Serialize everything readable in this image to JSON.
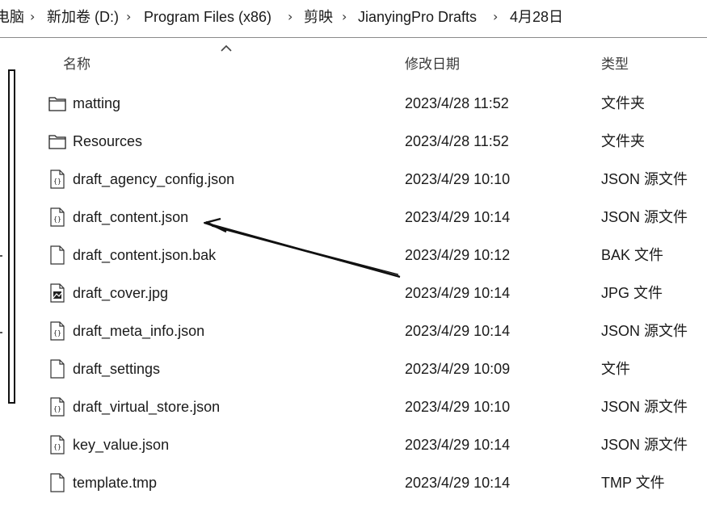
{
  "breadcrumb": [
    {
      "label": "电脑"
    },
    {
      "label": "新加卷 (D:)"
    },
    {
      "label": "Program Files (x86)"
    },
    {
      "label": "剪映"
    },
    {
      "label": "JianyingPro Drafts"
    },
    {
      "label": "4月28日"
    }
  ],
  "columns": {
    "name": "名称",
    "date": "修改日期",
    "type": "类型"
  },
  "files": [
    {
      "name": "matting",
      "date": "2023/4/28 11:52",
      "type": "文件夹",
      "icon": "folder-icon"
    },
    {
      "name": "Resources",
      "date": "2023/4/28 11:52",
      "type": "文件夹",
      "icon": "folder-icon"
    },
    {
      "name": "draft_agency_config.json",
      "date": "2023/4/29 10:10",
      "type": "JSON 源文件",
      "icon": "json-file-icon"
    },
    {
      "name": "draft_content.json",
      "date": "2023/4/29 10:14",
      "type": "JSON 源文件",
      "icon": "json-file-icon"
    },
    {
      "name": "draft_content.json.bak",
      "date": "2023/4/29 10:12",
      "type": "BAK 文件",
      "icon": "file-icon"
    },
    {
      "name": "draft_cover.jpg",
      "date": "2023/4/29 10:14",
      "type": "JPG 文件",
      "icon": "image-file-icon"
    },
    {
      "name": "draft_meta_info.json",
      "date": "2023/4/29 10:14",
      "type": "JSON 源文件",
      "icon": "json-file-icon"
    },
    {
      "name": "draft_settings",
      "date": "2023/4/29 10:09",
      "type": "文件",
      "icon": "file-icon"
    },
    {
      "name": "draft_virtual_store.json",
      "date": "2023/4/29 10:10",
      "type": "JSON 源文件",
      "icon": "json-file-icon"
    },
    {
      "name": "key_value.json",
      "date": "2023/4/29 10:14",
      "type": "JSON 源文件",
      "icon": "json-file-icon"
    },
    {
      "name": "template.tmp",
      "date": "2023/4/29 10:14",
      "type": "TMP 文件",
      "icon": "file-icon"
    }
  ],
  "annotation": {
    "icon": "pointer-arrow-annotation",
    "target": "draft_content.json"
  }
}
